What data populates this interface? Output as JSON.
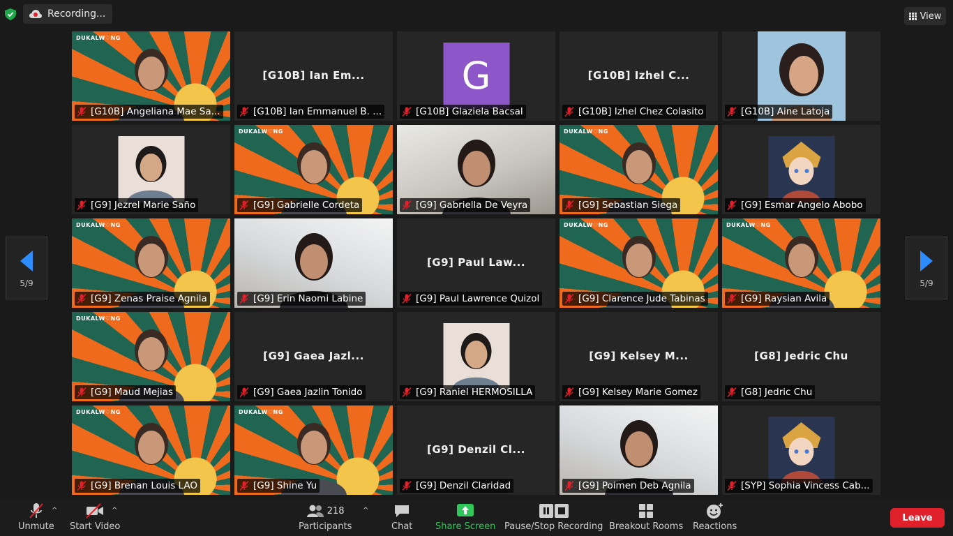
{
  "status": {
    "recording_label": "Recording...",
    "view_label": "View"
  },
  "pagination": {
    "left": "5/9",
    "right": "5/9"
  },
  "tiles": [
    {
      "name": "[G10B] Angeliana Mae Sa...",
      "kind": "banner"
    },
    {
      "name": "[G10B] Ian Emmanuel B. ...",
      "kind": "name",
      "center": "[G10B] Ian Em..."
    },
    {
      "name": "[G10B] Glaziela Bacsal",
      "kind": "avatar",
      "letter": "G"
    },
    {
      "name": "[G10B] Izhel Chez Colasito",
      "kind": "name",
      "center": "[G10B] Izhel C..."
    },
    {
      "name": "[G10B] Aine Latoja",
      "kind": "photo"
    },
    {
      "name": "[G9] Jezrel Marie Saño",
      "kind": "photo-small"
    },
    {
      "name": "[G9] Gabrielle Cordeta",
      "kind": "banner"
    },
    {
      "name": "[G9] Gabriella De Veyra",
      "kind": "room"
    },
    {
      "name": "[G9] Sebastian Siega",
      "kind": "banner"
    },
    {
      "name": "[G9] Esmar Angelo Abobo",
      "kind": "anime"
    },
    {
      "name": "[G9] Zenas Praise Agnila",
      "kind": "banner"
    },
    {
      "name": "[G9] Erin Naomi Labine",
      "kind": "room2"
    },
    {
      "name": "[G9] Paul Lawrence Quizol",
      "kind": "name",
      "center": "[G9] Paul Law..."
    },
    {
      "name": "[G9] Clarence Jude Tabinas",
      "kind": "banner"
    },
    {
      "name": "[G9] Raysian Avila",
      "kind": "banner"
    },
    {
      "name": "[G9] Maud Mejias",
      "kind": "banner"
    },
    {
      "name": "[G9] Gaea Jazlin Tonido",
      "kind": "name",
      "center": "[G9] Gaea Jazl..."
    },
    {
      "name": "[G9] Raniel HERMOSILLA",
      "kind": "photo-small"
    },
    {
      "name": "[G9] Kelsey Marie Gomez",
      "kind": "name",
      "center": "[G9] Kelsey M..."
    },
    {
      "name": "[G8] Jedric Chu",
      "kind": "name",
      "center": "[G8] Jedric Chu"
    },
    {
      "name": "[G9] Brenan Louis LAO",
      "kind": "banner"
    },
    {
      "name": "[G9] Shine Yu",
      "kind": "banner"
    },
    {
      "name": "[G9] Denzil Claridad",
      "kind": "name",
      "center": "[G9] Denzil Cl..."
    },
    {
      "name": "[G9] Poimen Deb Agnila",
      "kind": "room2"
    },
    {
      "name": "[SYP] Sophia Vincess Cab...",
      "kind": "anime"
    }
  ],
  "banner_logo": "DUKALW♡NG",
  "toolbar": {
    "unmute": "Unmute",
    "start_video": "Start Video",
    "participants": "Participants",
    "participant_count": "218",
    "chat": "Chat",
    "share_screen": "Share Screen",
    "pause_recording": "Pause/Stop Recording",
    "breakout_rooms": "Breakout Rooms",
    "reactions": "Reactions",
    "leave": "Leave"
  },
  "colors": {
    "leave": "#e0212b",
    "share_screen": "#30c75a",
    "arrow": "#2d8cff",
    "muted_mic": "#e0212b",
    "avatar": "#8d57c9"
  }
}
